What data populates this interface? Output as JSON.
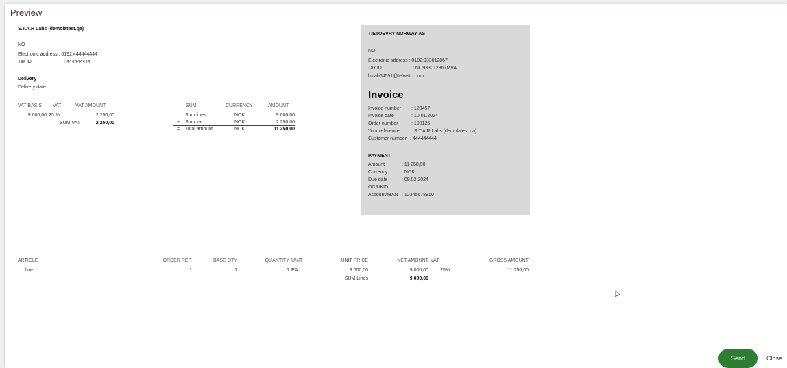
{
  "window": {
    "title": "Preview"
  },
  "sender": {
    "name": "S.T.A.R Labs (demolatest.qa)",
    "country": "NO",
    "electronic_address": "Electronic address : 0192:444444444",
    "tax_id_label": "Tax ID",
    "tax_id_value": ": 444444444",
    "delivery_heading": "Delivery",
    "delivery_date": "Delivery date :"
  },
  "vat_table": {
    "headers": [
      "VAT BASIS",
      "VAT",
      "VAT AMOUNT"
    ],
    "row": {
      "basis": "9 000,00",
      "vat": "25 %",
      "amount": "2 250,00"
    },
    "sum_label": "SUM VAT",
    "sum_value": "2 250,00"
  },
  "sum_table": {
    "headers": [
      "SUM",
      "CURRENCY",
      "AMOUNT"
    ],
    "rows": [
      {
        "prefix": "",
        "label": "Sum lines",
        "currency": "NOK",
        "amount": "9 000,00"
      },
      {
        "prefix": "+",
        "label": "Sum vat",
        "currency": "NOK",
        "amount": "2 250,00"
      },
      {
        "prefix": "=",
        "label": "Total amount",
        "currency": "NOK",
        "amount": "11 250,00"
      }
    ]
  },
  "receiver": {
    "name": "TIETOEVRY NORWAY AS",
    "country": "NO",
    "electronic_address": "Electronic address : 0192:933012867",
    "tax_id_label": "Tax ID",
    "tax_id_value": ": NO933012867MVA",
    "email": "limab64551@telvetto.com"
  },
  "invoice": {
    "heading": "Invoice",
    "fields": [
      {
        "label": "Invoice number",
        "value": ": 123457"
      },
      {
        "label": "Invoice date",
        "value": ": 10.01.2024"
      },
      {
        "label": "Order number",
        "value": ": 100125"
      },
      {
        "label": "Your reference",
        "value": ": S.T.A.R Labs (demolatest.qa)"
      },
      {
        "label": "Customer number",
        "value": ": 444444444"
      }
    ]
  },
  "payment": {
    "heading": "PAYMENT",
    "fields": [
      {
        "label": "Amount",
        "value": ": 11 250,00"
      },
      {
        "label": "Currency",
        "value": ": NOK"
      },
      {
        "label": "Due date",
        "value": ": 09.02.2024"
      },
      {
        "label": "OCR/KID",
        "value": ":"
      },
      {
        "label": "Account/IBAN",
        "value": ": 12345678910"
      }
    ]
  },
  "lines": {
    "headers": {
      "article": "ARTICLE",
      "order_ref": "ORDER REF.",
      "base_qty": "BASE QTY",
      "quantity": "QUANTITY",
      "unit": "UNIT",
      "unit_price": "UNIT PRICE",
      "net_amount": "NET AMOUNT",
      "vat": "VAT",
      "gross_amount": "GROSS AMOUNT"
    },
    "row": {
      "article": "line",
      "order_ref": "1",
      "base_qty": "1",
      "quantity": "1",
      "unit": "EA",
      "unit_price": "9 000,00",
      "net_amount": "9 000,00",
      "vat": "25%",
      "gross_amount": "11 250,00"
    },
    "sum_label": "SUM Lines",
    "sum_value": "9 000,00"
  },
  "footer": {
    "send_label": "Send",
    "close_label": "Close"
  },
  "colors": {
    "send_button": "#2e7d32",
    "receiver_box": "#d9d9d9"
  }
}
